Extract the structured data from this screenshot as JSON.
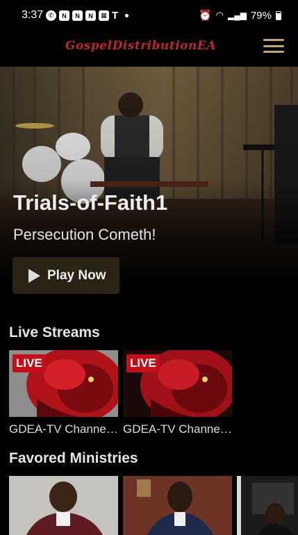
{
  "status_bar": {
    "time": "3:37",
    "left_icons": [
      "whatsapp-icon",
      "n-app-icon",
      "n-app-icon",
      "n-app-icon",
      "qr-app-icon",
      "t-mobile-icon"
    ],
    "battery": "79%"
  },
  "header": {
    "brand": "GospelDistributionEA"
  },
  "hero": {
    "title": "Trials-of-Faith1",
    "subtitle": "Persecution Cometh!",
    "play_label": "Play Now"
  },
  "live_streams": {
    "title": "Live Streams",
    "badge": "LIVE",
    "items": [
      {
        "title": "GDEA-TV Channel..."
      },
      {
        "title": "GDEA-TV Channel..."
      }
    ]
  },
  "favored_ministries": {
    "title": "Favored Ministries"
  },
  "colors": {
    "brand": "#c0272d",
    "menu": "#c8a56a",
    "live_badge": "#c31019",
    "play_button_bg": "#2a2416"
  }
}
